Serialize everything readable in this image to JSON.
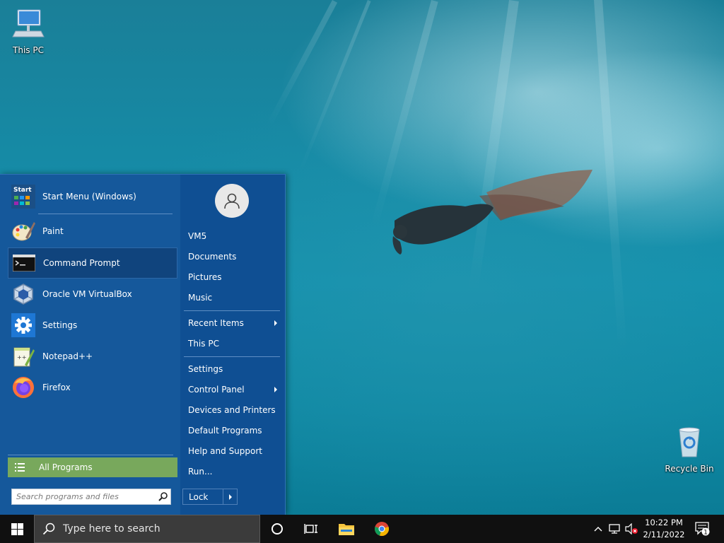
{
  "desktop": {
    "icons": [
      {
        "label": "This PC",
        "icon": "this-pc-icon"
      },
      {
        "label": "Recycle Bin",
        "icon": "recycle-bin-icon"
      }
    ]
  },
  "start_menu": {
    "pinned": [
      {
        "label": "Start Menu (Windows)",
        "icon": "start-menu-icon"
      },
      {
        "label": "Paint",
        "icon": "paint-icon"
      },
      {
        "label": "Command Prompt",
        "icon": "command-prompt-icon",
        "selected": true
      },
      {
        "label": "Oracle VM VirtualBox",
        "icon": "virtualbox-icon"
      },
      {
        "label": "Settings",
        "icon": "gear-icon"
      },
      {
        "label": "Notepad++",
        "icon": "notepad-plus-plus-icon"
      },
      {
        "label": "Firefox",
        "icon": "firefox-icon"
      }
    ],
    "start_icon_text": "Start",
    "all_programs": "All Programs",
    "search_placeholder": "Search programs and files",
    "user": {
      "name": "VM5",
      "icon": "user-avatar-icon"
    },
    "right_items": [
      {
        "label": "VM5",
        "has_submenu": false
      },
      {
        "label": "Documents",
        "has_submenu": false
      },
      {
        "label": "Pictures",
        "has_submenu": false
      },
      {
        "label": "Music",
        "has_submenu": false
      },
      {
        "label": "Recent Items",
        "has_submenu": true
      },
      {
        "label": "This PC",
        "has_submenu": false
      },
      {
        "label": "Settings",
        "has_submenu": false
      },
      {
        "label": "Control Panel",
        "has_submenu": true
      },
      {
        "label": "Devices and Printers",
        "has_submenu": false
      },
      {
        "label": "Default Programs",
        "has_submenu": false
      },
      {
        "label": "Help and Support",
        "has_submenu": false
      },
      {
        "label": "Run...",
        "has_submenu": false
      }
    ],
    "lock_label": "Lock"
  },
  "taskbar": {
    "search_placeholder": "Type here to search",
    "clock_time": "10:22 PM",
    "clock_date": "2/11/2022",
    "notification_count": "1"
  },
  "colors": {
    "menu_bg": "#0f4f93",
    "menu_left_bg": "#15589b",
    "all_programs_bg": "#78a85c",
    "taskbar_bg": "#101010"
  }
}
